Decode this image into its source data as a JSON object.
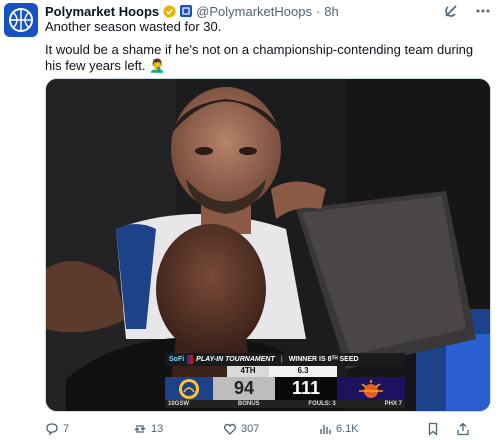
{
  "account": {
    "name": "Polymarket Hoops",
    "handle": "@PolymarketHoops",
    "separator": "·",
    "time": "8h"
  },
  "tweet": {
    "line1": "Another season wasted for 30.",
    "line2": "It would be a shame if he's not on a championship-contending team during his few years left. 🤦‍♂️"
  },
  "scorebug": {
    "brand": "SoFi",
    "event": "PLAY-IN TOURNAMENT",
    "note": "WINNER IS 8ᵀᴴ SEED",
    "quarter": "4TH",
    "clock": "6.3",
    "home_score": "94",
    "away_score": "111",
    "home_seed_team": "10GSW",
    "bonus": "BONUS",
    "fouls": "FOULS: 3",
    "away_team": "PHX",
    "away_seed": "7"
  },
  "actions": {
    "replies": "7",
    "reposts": "13",
    "likes": "307",
    "views": "6.1K"
  },
  "colors": {
    "brand_blue": "#1652c4",
    "verified_gold": "#e8b10a",
    "muted": "#536471"
  },
  "icons": [
    "basketball-logo-icon",
    "verified-badge-icon",
    "affiliate-badge-icon",
    "grok-icon",
    "more-icon",
    "reply-icon",
    "repost-icon",
    "like-icon",
    "views-icon",
    "bookmark-icon",
    "share-icon"
  ]
}
